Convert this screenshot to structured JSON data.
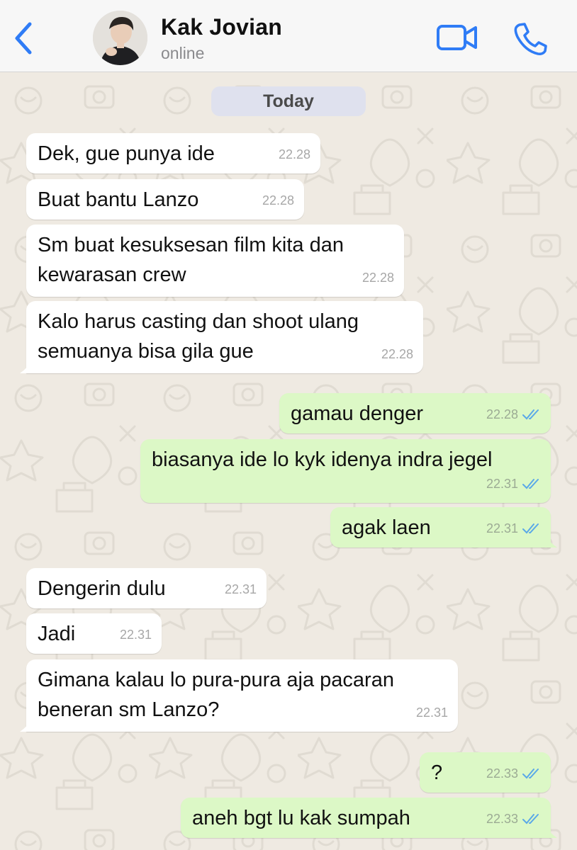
{
  "header": {
    "contact_name": "Kak Jovian",
    "status": "online",
    "back_icon": "chevron-left-icon",
    "video_icon": "video-camera-icon",
    "call_icon": "phone-icon",
    "accent_color": "#2f7cf6"
  },
  "chat": {
    "date_label": "Today",
    "messages": [
      {
        "direction": "incoming",
        "text": "Dek, gue punya ide",
        "time": "22.28"
      },
      {
        "direction": "incoming",
        "text": "Buat bantu Lanzo",
        "time": "22.28"
      },
      {
        "direction": "incoming",
        "text": "Sm buat kesuksesan film kita dan kewarasan crew",
        "time": "22.28"
      },
      {
        "direction": "incoming",
        "text": "Kalo harus casting dan shoot ulang semuanya bisa gila gue",
        "time": "22.28"
      },
      {
        "direction": "outgoing",
        "text": "gamau denger",
        "time": "22.28",
        "receipt": "read"
      },
      {
        "direction": "outgoing",
        "text": "biasanya ide lo kyk idenya indra jegel",
        "time": "22.31",
        "receipt": "read"
      },
      {
        "direction": "outgoing",
        "text": "agak laen",
        "time": "22.31",
        "receipt": "read"
      },
      {
        "direction": "incoming",
        "text": "Dengerin dulu",
        "time": "22.31"
      },
      {
        "direction": "incoming",
        "text": "Jadi",
        "time": "22.31"
      },
      {
        "direction": "incoming",
        "text": "Gimana kalau lo pura-pura aja pacaran beneran sm Lanzo?",
        "time": "22.31"
      },
      {
        "direction": "outgoing",
        "text": "?",
        "time": "22.33",
        "receipt": "read"
      },
      {
        "direction": "outgoing",
        "text": "aneh bgt lu kak sumpah",
        "time": "22.33",
        "receipt": "read"
      }
    ]
  },
  "colors": {
    "incoming_bubble": "#ffffff",
    "outgoing_bubble": "#dcf8c6",
    "read_receipt": "#5aa8e8",
    "wallpaper": "#efeae2"
  }
}
